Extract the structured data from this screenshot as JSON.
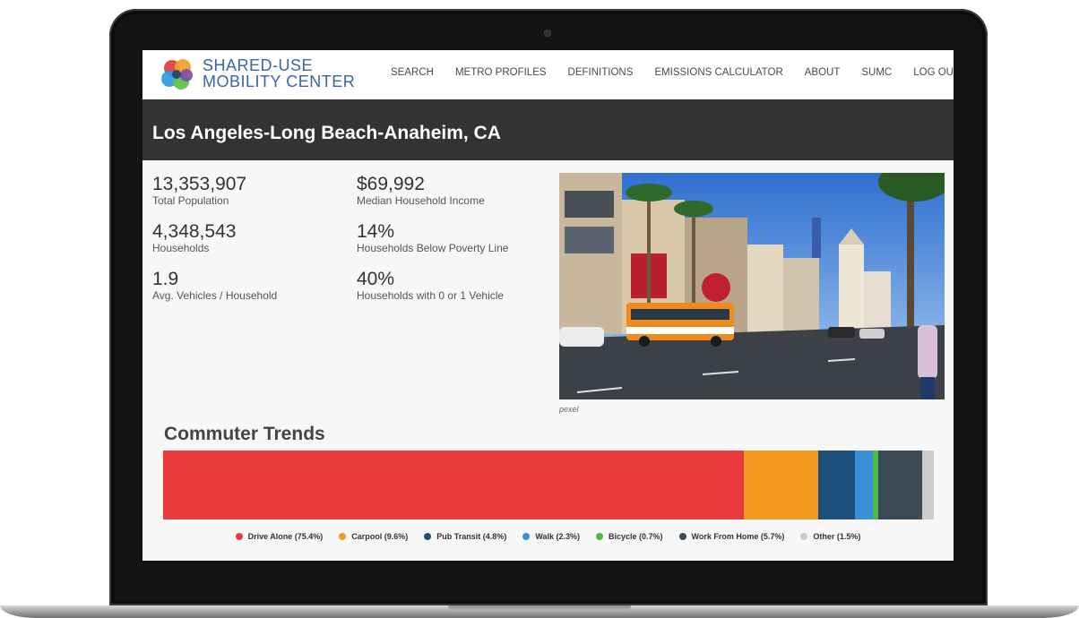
{
  "brand": {
    "line1": "SHARED-USE",
    "line2": "MOBILITY CENTER",
    "logo_colors": [
      "#e23c3c",
      "#f0a12a",
      "#2e9be0",
      "#5cbf4a",
      "#7b4fa0",
      "#213f78"
    ]
  },
  "nav": {
    "items": [
      "SEARCH",
      "METRO PROFILES",
      "DEFINITIONS",
      "EMISSIONS CALCULATOR",
      "ABOUT",
      "SUMC",
      "LOG OUT"
    ]
  },
  "page": {
    "title": "Los Angeles-Long Beach-Anaheim, CA"
  },
  "stats": {
    "total_population": {
      "value": "13,353,907",
      "label": "Total Population"
    },
    "households": {
      "value": "4,348,543",
      "label": "Households"
    },
    "avg_vehicles": {
      "value": "1.9",
      "label": "Avg. Vehicles / Household"
    },
    "median_income": {
      "value": "$69,992",
      "label": "Median Household Income"
    },
    "poverty": {
      "value": "14%",
      "label": "Households Below Poverty Line"
    },
    "low_vehicle": {
      "value": "40%",
      "label": "Households with 0 or 1 Vehicle"
    }
  },
  "photo": {
    "caption": "pexel"
  },
  "commuter_trends": {
    "title": "Commuter Trends",
    "segments": [
      {
        "label": "Drive Alone (75.4%)",
        "share": 75.4,
        "color": "#e93b3b"
      },
      {
        "label": "Carpool (9.6%)",
        "share": 9.6,
        "color": "#f29a22"
      },
      {
        "label": "Pub Transit (4.8%)",
        "share": 4.8,
        "color": "#1d4f7c"
      },
      {
        "label": "Walk (2.3%)",
        "share": 2.3,
        "color": "#3a8fd6"
      },
      {
        "label": "Bicycle (0.7%)",
        "share": 0.7,
        "color": "#4cbb47"
      },
      {
        "label": "Work From Home (5.7%)",
        "share": 5.7,
        "color": "#3b4a54"
      },
      {
        "label": "Other (1.5%)",
        "share": 1.5,
        "color": "#cccccc"
      }
    ]
  }
}
